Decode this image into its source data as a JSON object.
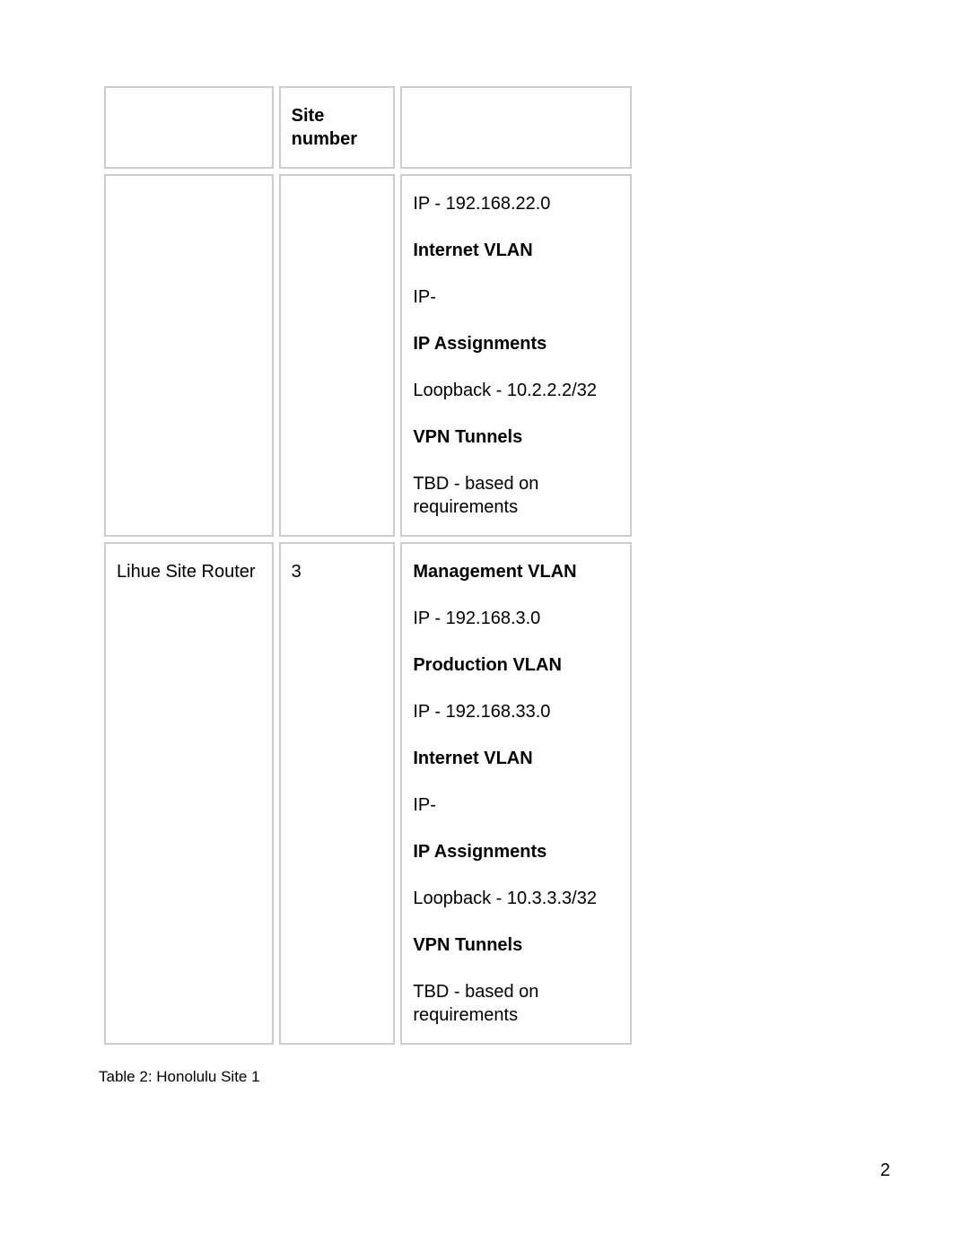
{
  "header": {
    "col1": "",
    "col2": "Site number",
    "col3": ""
  },
  "rows": [
    {
      "name": "",
      "number": "",
      "details": [
        {
          "bold": false,
          "text": "IP - 192.168.22.0"
        },
        {
          "bold": true,
          "text": "Internet VLAN"
        },
        {
          "bold": false,
          "text": "IP-"
        },
        {
          "bold": true,
          "text": "IP Assignments"
        },
        {
          "bold": false,
          "text": "Loopback - 10.2.2.2/32"
        },
        {
          "bold": true,
          "text": "VPN Tunnels"
        },
        {
          "bold": false,
          "text": "TBD - based on requirements"
        }
      ]
    },
    {
      "name": "Lihue Site Router",
      "number": "3",
      "details": [
        {
          "bold": true,
          "text": "Management VLAN"
        },
        {
          "bold": false,
          "text": "IP - 192.168.3.0"
        },
        {
          "bold": true,
          "text": "Production VLAN"
        },
        {
          "bold": false,
          "text": "IP - 192.168.33.0"
        },
        {
          "bold": true,
          "text": "Internet VLAN"
        },
        {
          "bold": false,
          "text": "IP-"
        },
        {
          "bold": true,
          "text": "IP Assignments"
        },
        {
          "bold": false,
          "text": "Loopback - 10.3.3.3/32"
        },
        {
          "bold": true,
          "text": "VPN Tunnels"
        },
        {
          "bold": false,
          "text": "TBD - based on requirements"
        }
      ]
    }
  ],
  "caption": "Table 2: Honolulu Site 1",
  "page_number": "2"
}
